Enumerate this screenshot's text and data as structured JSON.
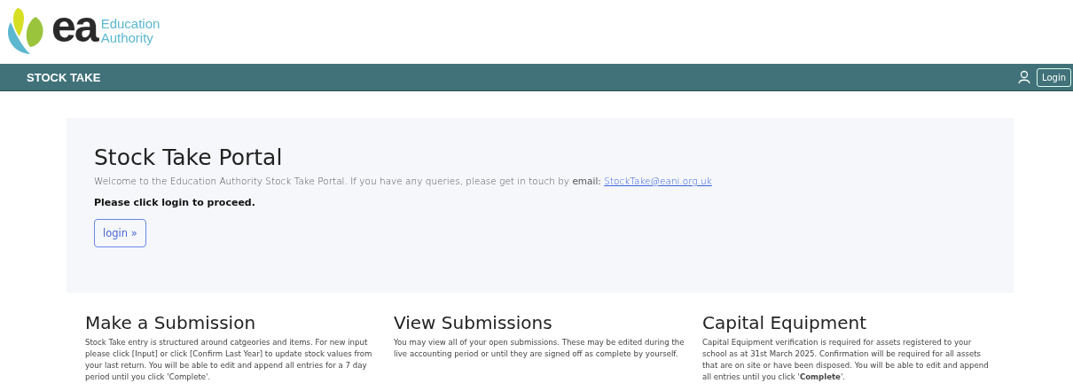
{
  "logo": {
    "mark": "ea",
    "name_lines": [
      "Education",
      "Authority"
    ]
  },
  "navbar": {
    "title": "STOCK TAKE",
    "login_button": "Login"
  },
  "portal": {
    "title": "Stock Take Portal",
    "intro": "Welcome to the Education Authority Stock Take Portal. If you have any queries, please get in touch by **email:**",
    "email_link": "StockTake@eani.org.uk",
    "prompt": "Please click login to proceed.",
    "login_button": "login »"
  },
  "sections": [
    {
      "title": "Make a Submission",
      "text": "Stock Take entry is structured around catgeories and items. For new input please click [Input] or click [Confirm Last Year] to update stock values from your last return. You will be able to edit and append all entries for a 7 day period until you click 'Complete'."
    },
    {
      "title": "View Submissions",
      "text": "You may view all of your open submissions. These may be edited during the live accounting period or until they are signed off as complete by yourself."
    },
    {
      "title": "Capital Equipment",
      "text": "Capital Equipment verification is required for assets registered to your school as at 31st March 2025. Confirmation will be required for all assets that are on site or have been disposed. You will be able to edit and append all entries until you click '**Complete**'."
    }
  ]
}
